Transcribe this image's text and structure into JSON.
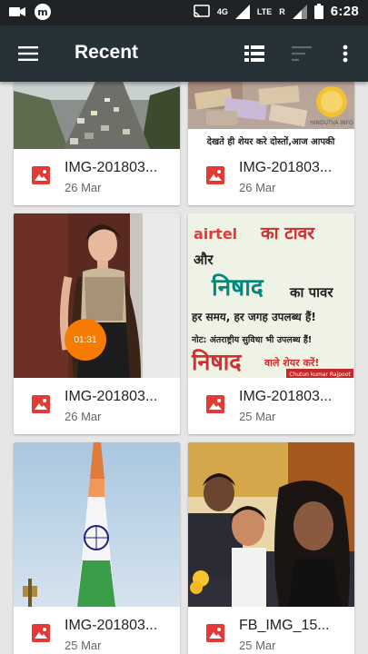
{
  "status_bar": {
    "network": "4G",
    "lte": "LTE",
    "roaming": "R",
    "time": "6:28"
  },
  "app_bar": {
    "title": "Recent"
  },
  "thumbnails": {
    "card2_caption": "देखते ही शेयर करे दोस्तों,आज आपकी",
    "card2_brand": "HINDUTVA INFO",
    "card4_airtel": "airtel",
    "card4_line1": "का टावर",
    "card4_line2": "और",
    "card4_line3": "निषाद",
    "card4_line4": "का पावर",
    "card4_line5": "हर समय, हर जगह उपलब्ध हैं!",
    "card4_line6": "नोट: अंतराष्ट्रीय सुविधा भी उपलब्ध हैं!",
    "card4_line7": "निषाद",
    "card4_line8": "वाले शेयर करें!",
    "card4_credit": "Chutun kumar Rajpoot"
  },
  "items": [
    {
      "name": "IMG-201803...",
      "date": "26 Mar"
    },
    {
      "name": "IMG-201803...",
      "date": "26 Mar"
    },
    {
      "name": "IMG-201803...",
      "date": "26 Mar",
      "duration": "01:31"
    },
    {
      "name": "IMG-201803...",
      "date": "25 Mar"
    },
    {
      "name": "IMG-201803...",
      "date": "25 Mar"
    },
    {
      "name": "FB_IMG_15...",
      "date": "25 Mar"
    }
  ],
  "colors": {
    "app_bar": "#263238",
    "status_bar": "#1f2326",
    "image_icon": "#e53935",
    "video_badge": "#f57c00"
  },
  "icons": {
    "menu": "hamburger-icon",
    "view": "list-view-icon",
    "sort": "sort-icon",
    "more": "more-vert-icon",
    "file": "image-icon"
  }
}
